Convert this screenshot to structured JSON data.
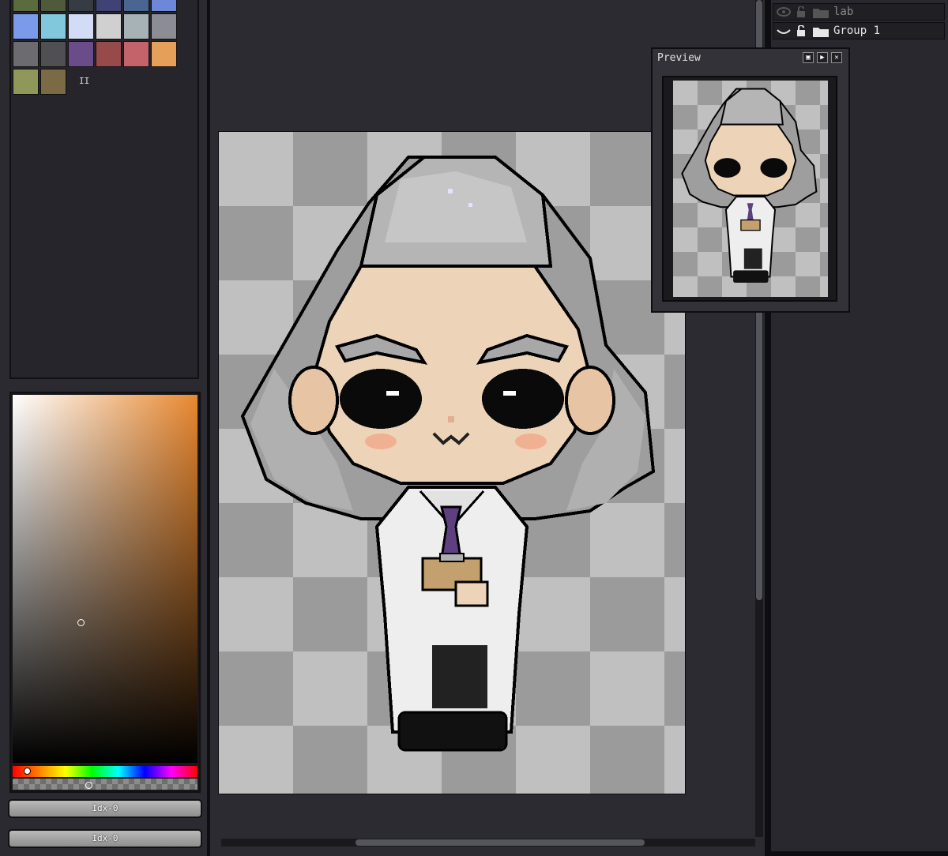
{
  "palette": {
    "swatches": [
      "#5a6b3d",
      "#4f5a3a",
      "#363b44",
      "#3f4275",
      "#4a6592",
      "#6d88d8",
      "#7b9bea",
      "#82c8dc",
      "#d3dcf6",
      "#cfd0cf",
      "#a7b2b7",
      "#8c8c95",
      "#6c6c70",
      "#505052",
      "#6a4c8a",
      "#964a4a",
      "#c4646a",
      "#e4a058",
      "#8f9859",
      "#7a6a46"
    ],
    "more_indicator": "II"
  },
  "color_picker": {
    "base_color": "#e88830",
    "idx_primary": "Idx-0",
    "idx_secondary": "Idx-0"
  },
  "preview": {
    "title": "Preview",
    "buttons": [
      "fit-icon",
      "play-icon",
      "close-icon"
    ]
  },
  "layers": [
    {
      "name": "lab",
      "type": "group",
      "visible": false,
      "locked": false
    },
    {
      "name": "Group 1",
      "type": "group",
      "visible": true,
      "locked": false
    }
  ]
}
